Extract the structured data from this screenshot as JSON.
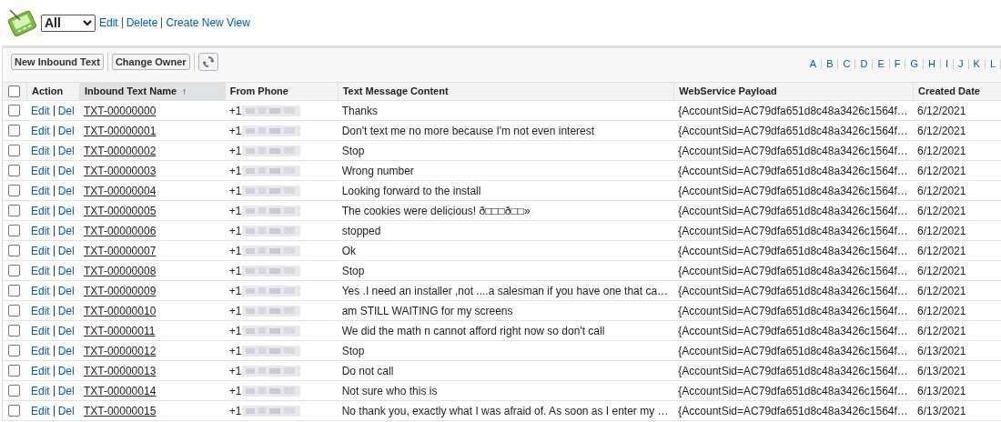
{
  "view_selector": {
    "value": "All",
    "links": [
      "Edit",
      "Delete",
      "Create New View"
    ]
  },
  "toolbar": {
    "buttons": [
      "New Inbound Text",
      "Change Owner"
    ],
    "alphabet": [
      "A",
      "B",
      "C",
      "D",
      "E",
      "F",
      "G",
      "H",
      "I",
      "J",
      "K",
      "L"
    ]
  },
  "table": {
    "select_all": {
      "checked": false
    },
    "columns": [
      {
        "label": "Action",
        "sorted": false
      },
      {
        "label": "Inbound Text Name",
        "sorted": true,
        "sort_icon": "↑"
      },
      {
        "label": "From Phone",
        "sorted": false
      },
      {
        "label": "Text Message Content",
        "sorted": false
      },
      {
        "label": "WebService Payload",
        "sorted": false
      },
      {
        "label": "Created Date",
        "sorted": false
      }
    ],
    "rows": [
      {
        "checked": false,
        "edit": "Edit",
        "del": "Del",
        "name": "TXT-00000000",
        "phone": "+1",
        "content": "Thanks",
        "payload": "{AccountSid=AC79dfa651d8c48a3426c1564f…",
        "date": "6/12/2021"
      },
      {
        "checked": false,
        "edit": "Edit",
        "del": "Del",
        "name": "TXT-00000001",
        "phone": "+1",
        "content": "Don't text me no more because I'm not even interest",
        "payload": "{AccountSid=AC79dfa651d8c48a3426c1564f…",
        "date": "6/12/2021"
      },
      {
        "checked": false,
        "edit": "Edit",
        "del": "Del",
        "name": "TXT-00000002",
        "phone": "+1",
        "content": "Stop",
        "payload": "{AccountSid=AC79dfa651d8c48a3426c1564f…",
        "date": "6/12/2021"
      },
      {
        "checked": false,
        "edit": "Edit",
        "del": "Del",
        "name": "TXT-00000003",
        "phone": "+1",
        "content": "Wrong number",
        "payload": "{AccountSid=AC79dfa651d8c48a3426c1564f…",
        "date": "6/12/2021"
      },
      {
        "checked": false,
        "edit": "Edit",
        "del": "Del",
        "name": "TXT-00000004",
        "phone": "+1",
        "content": "Looking forward to the install",
        "payload": "{AccountSid=AC79dfa651d8c48a3426c1564f…",
        "date": "6/12/2021"
      },
      {
        "checked": false,
        "edit": "Edit",
        "del": "Del",
        "name": "TXT-00000005",
        "phone": "+1",
        "content": "The cookies were delicious! ð□□□ð□□»",
        "payload": "{AccountSid=AC79dfa651d8c48a3426c1564f…",
        "date": "6/12/2021"
      },
      {
        "checked": false,
        "edit": "Edit",
        "del": "Del",
        "name": "TXT-00000006",
        "phone": "+1",
        "content": "stopped",
        "payload": "{AccountSid=AC79dfa651d8c48a3426c1564f…",
        "date": "6/12/2021"
      },
      {
        "checked": false,
        "edit": "Edit",
        "del": "Del",
        "name": "TXT-00000007",
        "phone": "+1",
        "content": "Ok",
        "payload": "{AccountSid=AC79dfa651d8c48a3426c1564f…",
        "date": "6/12/2021"
      },
      {
        "checked": false,
        "edit": "Edit",
        "del": "Del",
        "name": "TXT-00000008",
        "phone": "+1",
        "content": "Stop",
        "payload": "{AccountSid=AC79dfa651d8c48a3426c1564f…",
        "date": "6/12/2021"
      },
      {
        "checked": false,
        "edit": "Edit",
        "del": "Del",
        "name": "TXT-00000009",
        "phone": "+1",
        "content": "Yes .I need an installer ,not ....a salesman if you have one that ca…",
        "payload": "{AccountSid=AC79dfa651d8c48a3426c1564f…",
        "date": "6/12/2021"
      },
      {
        "checked": false,
        "edit": "Edit",
        "del": "Del",
        "name": "TXT-00000010",
        "phone": "+1",
        "content": "am STILL WAITING for my screens",
        "payload": "{AccountSid=AC79dfa651d8c48a3426c1564f…",
        "date": "6/12/2021"
      },
      {
        "checked": false,
        "edit": "Edit",
        "del": "Del",
        "name": "TXT-00000011",
        "phone": "+1",
        "content": "We did the math n cannot afford right now so don't call",
        "payload": "{AccountSid=AC79dfa651d8c48a3426c1564f…",
        "date": "6/12/2021"
      },
      {
        "checked": false,
        "edit": "Edit",
        "del": "Del",
        "name": "TXT-00000012",
        "phone": "+1",
        "content": "Stop",
        "payload": "{AccountSid=AC79dfa651d8c48a3426c1564f…",
        "date": "6/13/2021"
      },
      {
        "checked": false,
        "edit": "Edit",
        "del": "Del",
        "name": "TXT-00000013",
        "phone": "+1",
        "content": "Do not call",
        "payload": "{AccountSid=AC79dfa651d8c48a3426c1564f…",
        "date": "6/13/2021"
      },
      {
        "checked": false,
        "edit": "Edit",
        "del": "Del",
        "name": "TXT-00000014",
        "phone": "+1",
        "content": "Not sure who this is",
        "payload": "{AccountSid=AC79dfa651d8c48a3426c1564f…",
        "date": "6/13/2021"
      },
      {
        "checked": false,
        "edit": "Edit",
        "del": "Del",
        "name": "TXT-00000015",
        "phone": "+1",
        "content": "No thank you, exactly what I was afraid of. As soon as I enter my …",
        "payload": "{AccountSid=AC79dfa651d8c48a3426c1564f…",
        "date": "6/13/2021"
      }
    ]
  }
}
